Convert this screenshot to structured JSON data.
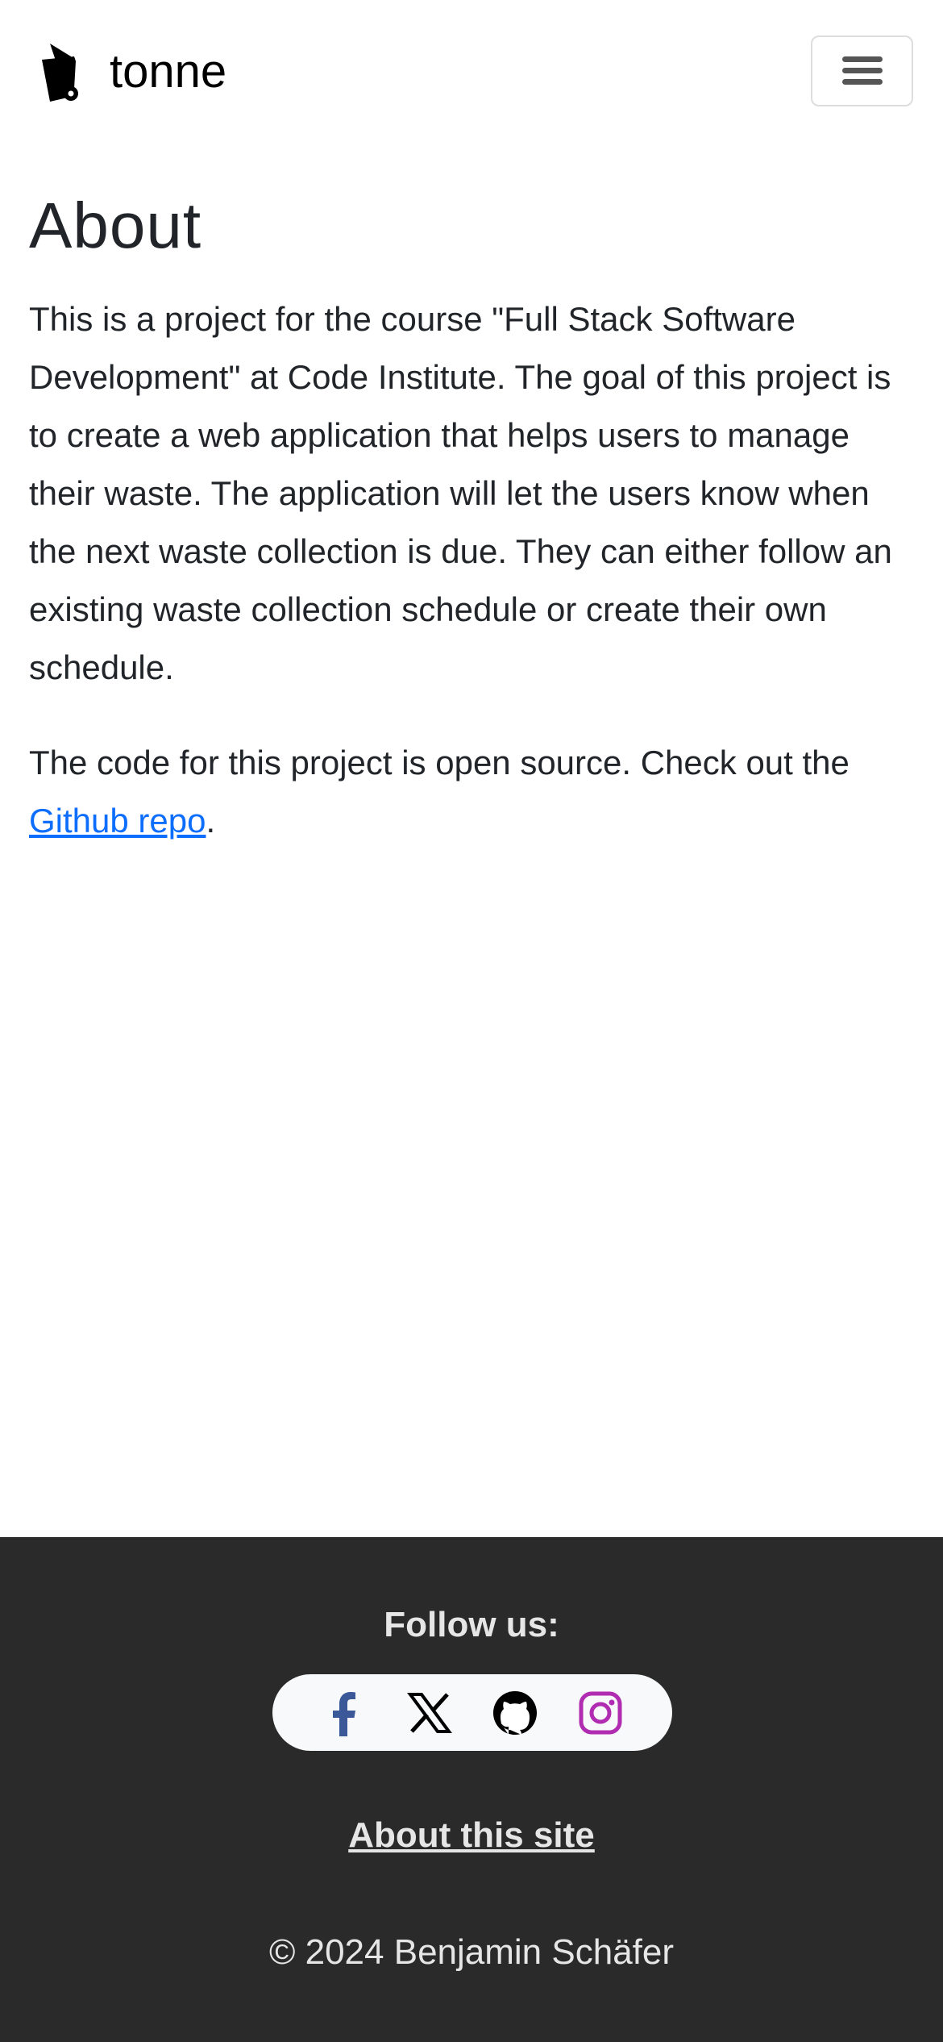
{
  "header": {
    "brand": "tonne",
    "menu_icon": "hamburger-icon"
  },
  "main": {
    "title": "About",
    "paragraph1": "This is a project for the course \"Full Stack Software Development\" at Code Institute. The goal of this project is to create a web application that helps users to manage their waste. The application will let the users know when the next waste collection is due. They can either follow an existing waste collection schedule or create their own schedule.",
    "paragraph2_before": "The code for this project is open source. Check out the ",
    "paragraph2_link": "Github repo",
    "paragraph2_after": "."
  },
  "footer": {
    "follow_label": "Follow us:",
    "social": [
      "facebook-icon",
      "x-icon",
      "github-icon",
      "instagram-icon"
    ],
    "about_link": "About this site",
    "copyright": "© 2024 Benjamin Schäfer"
  },
  "colors": {
    "link": "#0d6efd",
    "footer_bg": "#2a2a2a",
    "facebook": "#3b5998",
    "instagram": "#b02cb0"
  }
}
